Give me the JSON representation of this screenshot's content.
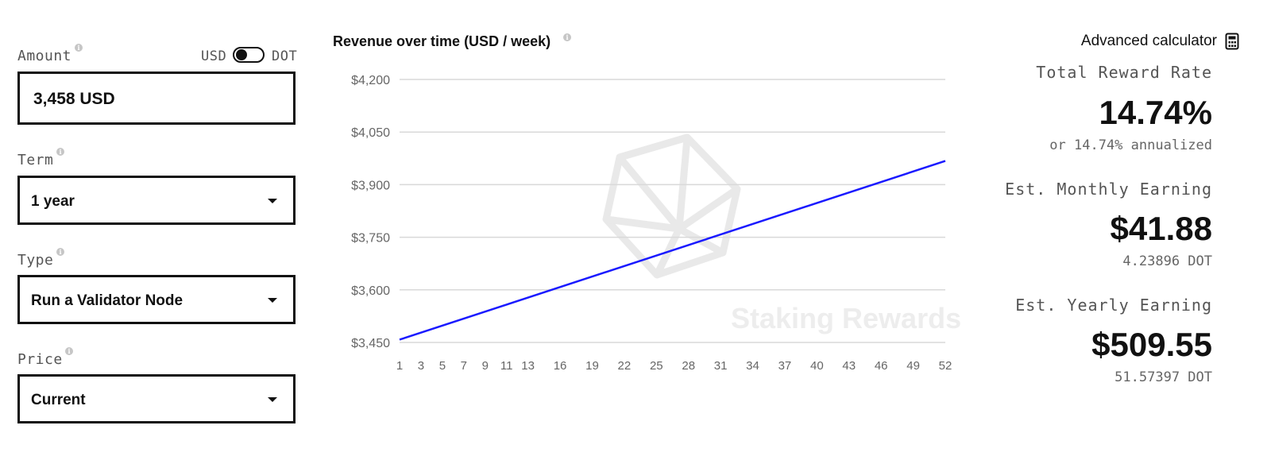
{
  "amount": {
    "label": "Amount",
    "value": "3,458 USD"
  },
  "currency_toggle": {
    "left": "USD",
    "right": "DOT",
    "selected": "USD"
  },
  "term": {
    "label": "Term",
    "selected": "1 year"
  },
  "type": {
    "label": "Type",
    "selected": "Run a Validator Node"
  },
  "price": {
    "label": "Price",
    "selected": "Current"
  },
  "advanced_calculator": {
    "label": "Advanced calculator",
    "icon": "calculator-icon"
  },
  "stats": {
    "reward_rate_label": "Total Reward Rate",
    "reward_rate_value": "14.74%",
    "reward_rate_sub": "or 14.74% annualized",
    "monthly_label": "Est. Monthly Earning",
    "monthly_value": "$41.88",
    "monthly_sub": "4.23896 DOT",
    "yearly_label": "Est. Yearly Earning",
    "yearly_value": "$509.55",
    "yearly_sub": "51.57397 DOT"
  },
  "watermark": "Staking Rewards",
  "colors": {
    "line": "#1a1aff",
    "grid": "#d9d9d9",
    "border": "#111111"
  },
  "chart_data": {
    "type": "line",
    "title": "Revenue over time (USD / week)",
    "xlabel": "",
    "ylabel": "",
    "x_tick_labels": [
      "1",
      "3",
      "5",
      "7",
      "9",
      "11",
      "13",
      "16",
      "19",
      "22",
      "25",
      "28",
      "31",
      "34",
      "37",
      "40",
      "43",
      "46",
      "49",
      "52"
    ],
    "y_tick_labels": [
      "$4,200",
      "$4,050",
      "$3,900",
      "$3,750",
      "$3,600",
      "$3,450"
    ],
    "y_ticks": [
      4200,
      4050,
      3900,
      3750,
      3600,
      3450
    ],
    "xlim": [
      1,
      52
    ],
    "ylim": [
      3450,
      4200
    ],
    "grid": true,
    "series": [
      {
        "x": [
          1,
          52
        ],
        "values": [
          3458,
          3967.55
        ]
      }
    ]
  }
}
